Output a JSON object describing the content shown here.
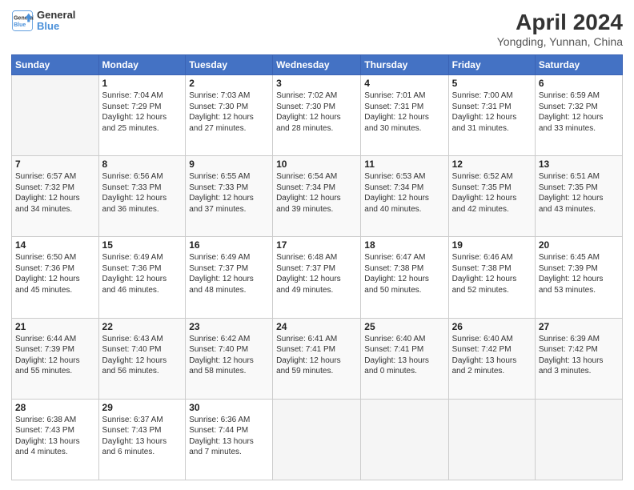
{
  "header": {
    "logo_line1": "General",
    "logo_line2": "Blue",
    "title": "April 2024",
    "subtitle": "Yongding, Yunnan, China"
  },
  "columns": [
    "Sunday",
    "Monday",
    "Tuesday",
    "Wednesday",
    "Thursday",
    "Friday",
    "Saturday"
  ],
  "weeks": [
    [
      {
        "num": "",
        "empty": true
      },
      {
        "num": "1",
        "rise": "7:04 AM",
        "set": "7:29 PM",
        "daylight": "12 hours and 25 minutes."
      },
      {
        "num": "2",
        "rise": "7:03 AM",
        "set": "7:30 PM",
        "daylight": "12 hours and 27 minutes."
      },
      {
        "num": "3",
        "rise": "7:02 AM",
        "set": "7:30 PM",
        "daylight": "12 hours and 28 minutes."
      },
      {
        "num": "4",
        "rise": "7:01 AM",
        "set": "7:31 PM",
        "daylight": "12 hours and 30 minutes."
      },
      {
        "num": "5",
        "rise": "7:00 AM",
        "set": "7:31 PM",
        "daylight": "12 hours and 31 minutes."
      },
      {
        "num": "6",
        "rise": "6:59 AM",
        "set": "7:32 PM",
        "daylight": "12 hours and 33 minutes."
      }
    ],
    [
      {
        "num": "7",
        "rise": "6:57 AM",
        "set": "7:32 PM",
        "daylight": "12 hours and 34 minutes."
      },
      {
        "num": "8",
        "rise": "6:56 AM",
        "set": "7:33 PM",
        "daylight": "12 hours and 36 minutes."
      },
      {
        "num": "9",
        "rise": "6:55 AM",
        "set": "7:33 PM",
        "daylight": "12 hours and 37 minutes."
      },
      {
        "num": "10",
        "rise": "6:54 AM",
        "set": "7:34 PM",
        "daylight": "12 hours and 39 minutes."
      },
      {
        "num": "11",
        "rise": "6:53 AM",
        "set": "7:34 PM",
        "daylight": "12 hours and 40 minutes."
      },
      {
        "num": "12",
        "rise": "6:52 AM",
        "set": "7:35 PM",
        "daylight": "12 hours and 42 minutes."
      },
      {
        "num": "13",
        "rise": "6:51 AM",
        "set": "7:35 PM",
        "daylight": "12 hours and 43 minutes."
      }
    ],
    [
      {
        "num": "14",
        "rise": "6:50 AM",
        "set": "7:36 PM",
        "daylight": "12 hours and 45 minutes."
      },
      {
        "num": "15",
        "rise": "6:49 AM",
        "set": "7:36 PM",
        "daylight": "12 hours and 46 minutes."
      },
      {
        "num": "16",
        "rise": "6:49 AM",
        "set": "7:37 PM",
        "daylight": "12 hours and 48 minutes."
      },
      {
        "num": "17",
        "rise": "6:48 AM",
        "set": "7:37 PM",
        "daylight": "12 hours and 49 minutes."
      },
      {
        "num": "18",
        "rise": "6:47 AM",
        "set": "7:38 PM",
        "daylight": "12 hours and 50 minutes."
      },
      {
        "num": "19",
        "rise": "6:46 AM",
        "set": "7:38 PM",
        "daylight": "12 hours and 52 minutes."
      },
      {
        "num": "20",
        "rise": "6:45 AM",
        "set": "7:39 PM",
        "daylight": "12 hours and 53 minutes."
      }
    ],
    [
      {
        "num": "21",
        "rise": "6:44 AM",
        "set": "7:39 PM",
        "daylight": "12 hours and 55 minutes."
      },
      {
        "num": "22",
        "rise": "6:43 AM",
        "set": "7:40 PM",
        "daylight": "12 hours and 56 minutes."
      },
      {
        "num": "23",
        "rise": "6:42 AM",
        "set": "7:40 PM",
        "daylight": "12 hours and 58 minutes."
      },
      {
        "num": "24",
        "rise": "6:41 AM",
        "set": "7:41 PM",
        "daylight": "12 hours and 59 minutes."
      },
      {
        "num": "25",
        "rise": "6:40 AM",
        "set": "7:41 PM",
        "daylight": "13 hours and 0 minutes."
      },
      {
        "num": "26",
        "rise": "6:40 AM",
        "set": "7:42 PM",
        "daylight": "13 hours and 2 minutes."
      },
      {
        "num": "27",
        "rise": "6:39 AM",
        "set": "7:42 PM",
        "daylight": "13 hours and 3 minutes."
      }
    ],
    [
      {
        "num": "28",
        "rise": "6:38 AM",
        "set": "7:43 PM",
        "daylight": "13 hours and 4 minutes."
      },
      {
        "num": "29",
        "rise": "6:37 AM",
        "set": "7:43 PM",
        "daylight": "13 hours and 6 minutes."
      },
      {
        "num": "30",
        "rise": "6:36 AM",
        "set": "7:44 PM",
        "daylight": "13 hours and 7 minutes."
      },
      {
        "num": "",
        "empty": true
      },
      {
        "num": "",
        "empty": true
      },
      {
        "num": "",
        "empty": true
      },
      {
        "num": "",
        "empty": true
      }
    ]
  ],
  "labels": {
    "sunrise": "Sunrise:",
    "sunset": "Sunset:",
    "daylight": "Daylight:"
  }
}
